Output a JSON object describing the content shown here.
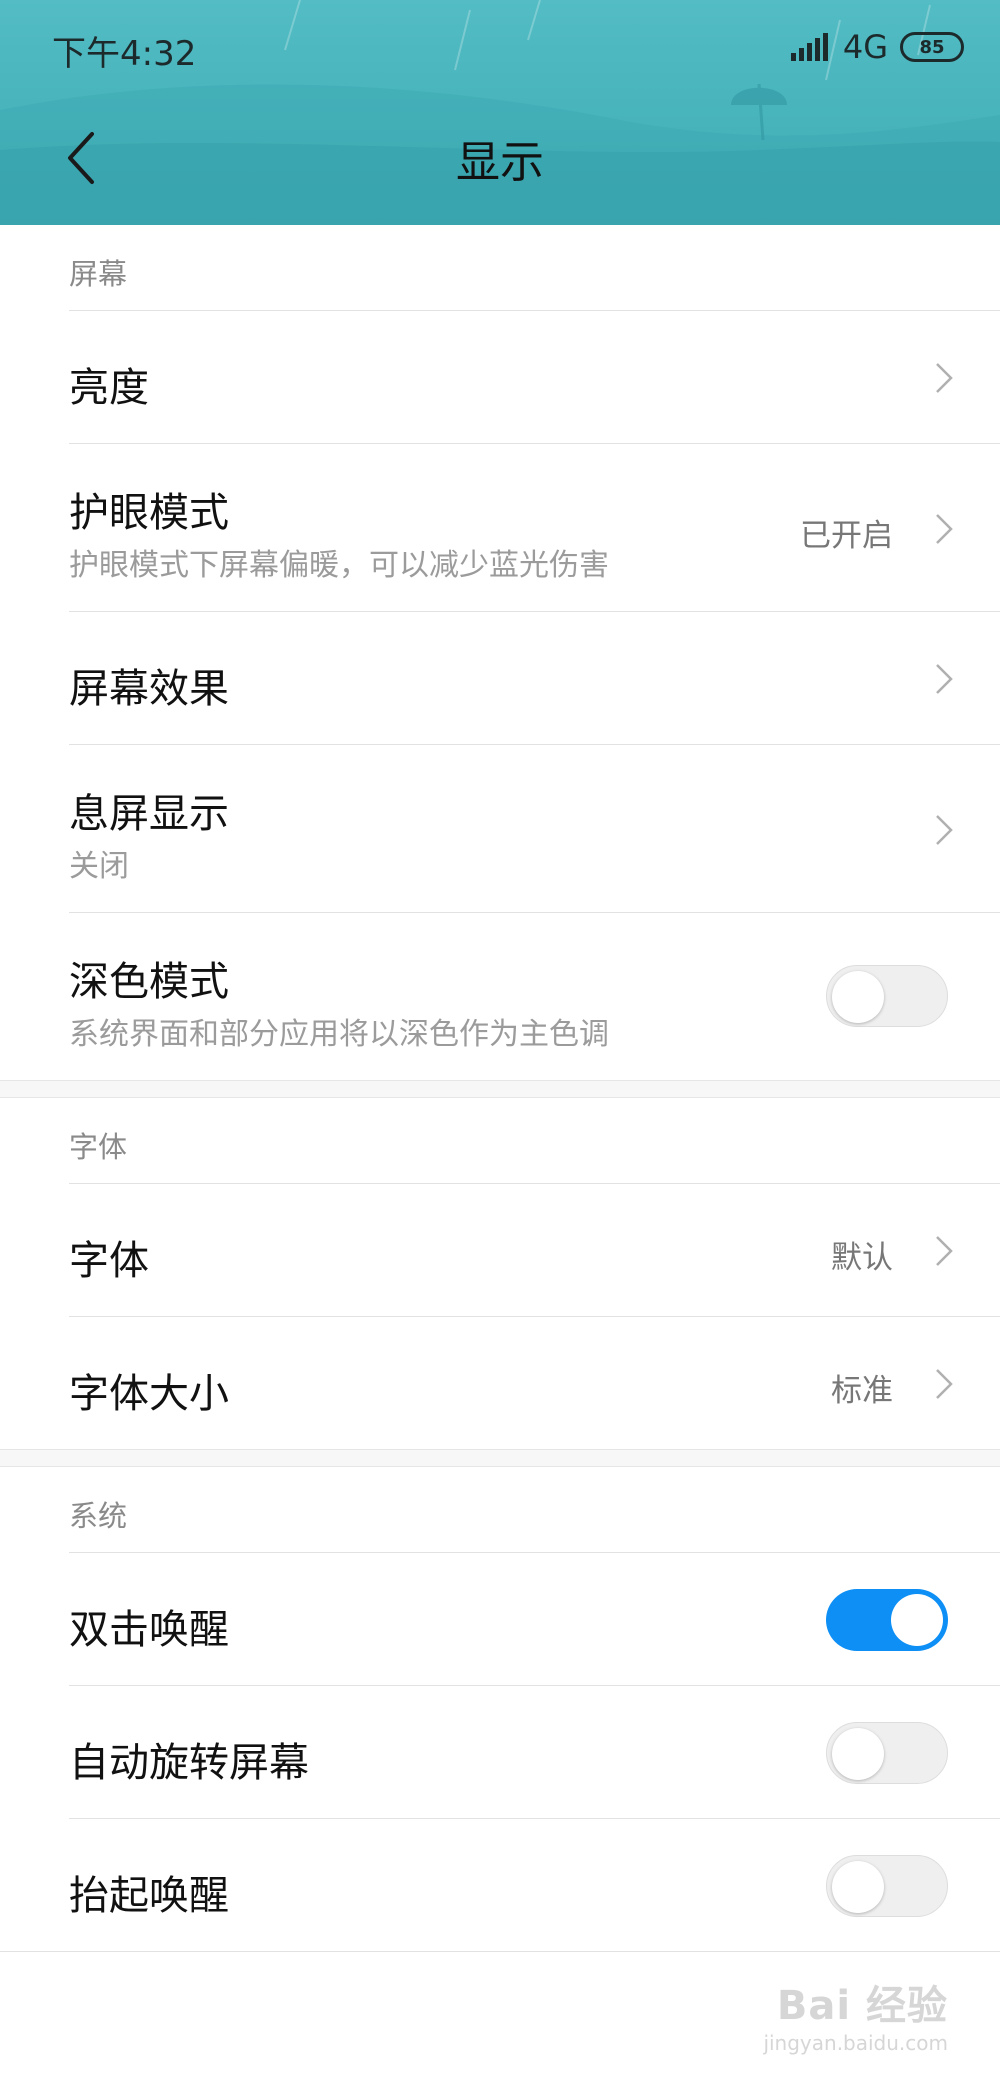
{
  "status_bar": {
    "time": "下午4:32",
    "network": "4G",
    "battery": "85",
    "signal_icon": "signal-bars-icon"
  },
  "header": {
    "title": "显示",
    "back_icon": "chevron-left-icon"
  },
  "sections": [
    {
      "label": "屏幕",
      "items": [
        {
          "title": "亮度",
          "control": "chevron"
        },
        {
          "title": "护眼模式",
          "subtitle": "护眼模式下屏幕偏暖，可以减少蓝光伤害",
          "value": "已开启",
          "control": "chevron"
        },
        {
          "title": "屏幕效果",
          "control": "chevron"
        },
        {
          "title": "息屏显示",
          "subtitle": "关闭",
          "control": "chevron"
        },
        {
          "title": "深色模式",
          "subtitle": "系统界面和部分应用将以深色作为主色调",
          "control": "toggle",
          "enabled": false
        }
      ]
    },
    {
      "label": "字体",
      "items": [
        {
          "title": "字体",
          "value": "默认",
          "control": "chevron"
        },
        {
          "title": "字体大小",
          "value": "标准",
          "control": "chevron"
        }
      ]
    },
    {
      "label": "系统",
      "items": [
        {
          "title": "双击唤醒",
          "control": "toggle",
          "enabled": true
        },
        {
          "title": "自动旋转屏幕",
          "control": "toggle",
          "enabled": false
        },
        {
          "title": "抬起唤醒",
          "control": "toggle",
          "enabled": false
        }
      ]
    }
  ],
  "watermark": {
    "main": "Bai 经验",
    "sub": "jingyan.baidu.com"
  },
  "colors": {
    "header": "#46b2ba",
    "toggle_on": "#0d8ff5",
    "toggle_off": "#efefef"
  }
}
